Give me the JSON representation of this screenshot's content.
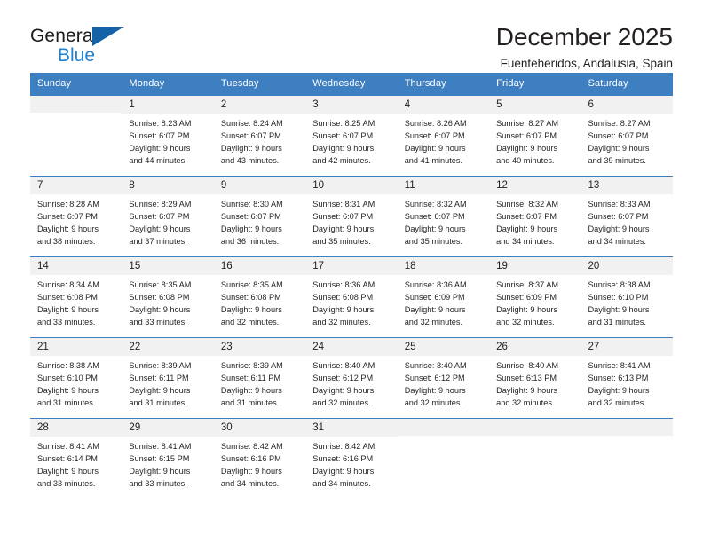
{
  "brand": {
    "word_one": "General",
    "word_two": "Blue",
    "triangle_icon": "triangle-icon"
  },
  "header": {
    "month_title": "December 2025",
    "location": "Fuenteheridos, Andalusia, Spain"
  },
  "colors": {
    "header_blue": "#3d7fc1",
    "brand_dark_blue": "#1463a8",
    "brand_light_blue": "#2083d2",
    "daynum_band": "#f1f1f1",
    "text": "#231f20"
  },
  "calendar": {
    "weekday_headers": [
      "Sunday",
      "Monday",
      "Tuesday",
      "Wednesday",
      "Thursday",
      "Friday",
      "Saturday"
    ],
    "labels": {
      "sunrise_prefix": "Sunrise:",
      "sunset_prefix": "Sunset:",
      "daylight_prefix": "Daylight:"
    },
    "weeks": [
      [
        {
          "day": "",
          "empty": true
        },
        {
          "day": "1",
          "sunrise": "Sunrise: 8:23 AM",
          "sunset": "Sunset: 6:07 PM",
          "daylight_l1": "Daylight: 9 hours",
          "daylight_l2": "and 44 minutes."
        },
        {
          "day": "2",
          "sunrise": "Sunrise: 8:24 AM",
          "sunset": "Sunset: 6:07 PM",
          "daylight_l1": "Daylight: 9 hours",
          "daylight_l2": "and 43 minutes."
        },
        {
          "day": "3",
          "sunrise": "Sunrise: 8:25 AM",
          "sunset": "Sunset: 6:07 PM",
          "daylight_l1": "Daylight: 9 hours",
          "daylight_l2": "and 42 minutes."
        },
        {
          "day": "4",
          "sunrise": "Sunrise: 8:26 AM",
          "sunset": "Sunset: 6:07 PM",
          "daylight_l1": "Daylight: 9 hours",
          "daylight_l2": "and 41 minutes."
        },
        {
          "day": "5",
          "sunrise": "Sunrise: 8:27 AM",
          "sunset": "Sunset: 6:07 PM",
          "daylight_l1": "Daylight: 9 hours",
          "daylight_l2": "and 40 minutes."
        },
        {
          "day": "6",
          "sunrise": "Sunrise: 8:27 AM",
          "sunset": "Sunset: 6:07 PM",
          "daylight_l1": "Daylight: 9 hours",
          "daylight_l2": "and 39 minutes."
        }
      ],
      [
        {
          "day": "7",
          "sunrise": "Sunrise: 8:28 AM",
          "sunset": "Sunset: 6:07 PM",
          "daylight_l1": "Daylight: 9 hours",
          "daylight_l2": "and 38 minutes."
        },
        {
          "day": "8",
          "sunrise": "Sunrise: 8:29 AM",
          "sunset": "Sunset: 6:07 PM",
          "daylight_l1": "Daylight: 9 hours",
          "daylight_l2": "and 37 minutes."
        },
        {
          "day": "9",
          "sunrise": "Sunrise: 8:30 AM",
          "sunset": "Sunset: 6:07 PM",
          "daylight_l1": "Daylight: 9 hours",
          "daylight_l2": "and 36 minutes."
        },
        {
          "day": "10",
          "sunrise": "Sunrise: 8:31 AM",
          "sunset": "Sunset: 6:07 PM",
          "daylight_l1": "Daylight: 9 hours",
          "daylight_l2": "and 35 minutes."
        },
        {
          "day": "11",
          "sunrise": "Sunrise: 8:32 AM",
          "sunset": "Sunset: 6:07 PM",
          "daylight_l1": "Daylight: 9 hours",
          "daylight_l2": "and 35 minutes."
        },
        {
          "day": "12",
          "sunrise": "Sunrise: 8:32 AM",
          "sunset": "Sunset: 6:07 PM",
          "daylight_l1": "Daylight: 9 hours",
          "daylight_l2": "and 34 minutes."
        },
        {
          "day": "13",
          "sunrise": "Sunrise: 8:33 AM",
          "sunset": "Sunset: 6:07 PM",
          "daylight_l1": "Daylight: 9 hours",
          "daylight_l2": "and 34 minutes."
        }
      ],
      [
        {
          "day": "14",
          "sunrise": "Sunrise: 8:34 AM",
          "sunset": "Sunset: 6:08 PM",
          "daylight_l1": "Daylight: 9 hours",
          "daylight_l2": "and 33 minutes."
        },
        {
          "day": "15",
          "sunrise": "Sunrise: 8:35 AM",
          "sunset": "Sunset: 6:08 PM",
          "daylight_l1": "Daylight: 9 hours",
          "daylight_l2": "and 33 minutes."
        },
        {
          "day": "16",
          "sunrise": "Sunrise: 8:35 AM",
          "sunset": "Sunset: 6:08 PM",
          "daylight_l1": "Daylight: 9 hours",
          "daylight_l2": "and 32 minutes."
        },
        {
          "day": "17",
          "sunrise": "Sunrise: 8:36 AM",
          "sunset": "Sunset: 6:08 PM",
          "daylight_l1": "Daylight: 9 hours",
          "daylight_l2": "and 32 minutes."
        },
        {
          "day": "18",
          "sunrise": "Sunrise: 8:36 AM",
          "sunset": "Sunset: 6:09 PM",
          "daylight_l1": "Daylight: 9 hours",
          "daylight_l2": "and 32 minutes."
        },
        {
          "day": "19",
          "sunrise": "Sunrise: 8:37 AM",
          "sunset": "Sunset: 6:09 PM",
          "daylight_l1": "Daylight: 9 hours",
          "daylight_l2": "and 32 minutes."
        },
        {
          "day": "20",
          "sunrise": "Sunrise: 8:38 AM",
          "sunset": "Sunset: 6:10 PM",
          "daylight_l1": "Daylight: 9 hours",
          "daylight_l2": "and 31 minutes."
        }
      ],
      [
        {
          "day": "21",
          "sunrise": "Sunrise: 8:38 AM",
          "sunset": "Sunset: 6:10 PM",
          "daylight_l1": "Daylight: 9 hours",
          "daylight_l2": "and 31 minutes."
        },
        {
          "day": "22",
          "sunrise": "Sunrise: 8:39 AM",
          "sunset": "Sunset: 6:11 PM",
          "daylight_l1": "Daylight: 9 hours",
          "daylight_l2": "and 31 minutes."
        },
        {
          "day": "23",
          "sunrise": "Sunrise: 8:39 AM",
          "sunset": "Sunset: 6:11 PM",
          "daylight_l1": "Daylight: 9 hours",
          "daylight_l2": "and 31 minutes."
        },
        {
          "day": "24",
          "sunrise": "Sunrise: 8:40 AM",
          "sunset": "Sunset: 6:12 PM",
          "daylight_l1": "Daylight: 9 hours",
          "daylight_l2": "and 32 minutes."
        },
        {
          "day": "25",
          "sunrise": "Sunrise: 8:40 AM",
          "sunset": "Sunset: 6:12 PM",
          "daylight_l1": "Daylight: 9 hours",
          "daylight_l2": "and 32 minutes."
        },
        {
          "day": "26",
          "sunrise": "Sunrise: 8:40 AM",
          "sunset": "Sunset: 6:13 PM",
          "daylight_l1": "Daylight: 9 hours",
          "daylight_l2": "and 32 minutes."
        },
        {
          "day": "27",
          "sunrise": "Sunrise: 8:41 AM",
          "sunset": "Sunset: 6:13 PM",
          "daylight_l1": "Daylight: 9 hours",
          "daylight_l2": "and 32 minutes."
        }
      ],
      [
        {
          "day": "28",
          "sunrise": "Sunrise: 8:41 AM",
          "sunset": "Sunset: 6:14 PM",
          "daylight_l1": "Daylight: 9 hours",
          "daylight_l2": "and 33 minutes."
        },
        {
          "day": "29",
          "sunrise": "Sunrise: 8:41 AM",
          "sunset": "Sunset: 6:15 PM",
          "daylight_l1": "Daylight: 9 hours",
          "daylight_l2": "and 33 minutes."
        },
        {
          "day": "30",
          "sunrise": "Sunrise: 8:42 AM",
          "sunset": "Sunset: 6:16 PM",
          "daylight_l1": "Daylight: 9 hours",
          "daylight_l2": "and 34 minutes."
        },
        {
          "day": "31",
          "sunrise": "Sunrise: 8:42 AM",
          "sunset": "Sunset: 6:16 PM",
          "daylight_l1": "Daylight: 9 hours",
          "daylight_l2": "and 34 minutes."
        },
        {
          "day": "",
          "empty": true
        },
        {
          "day": "",
          "empty": true
        },
        {
          "day": "",
          "empty": true
        }
      ]
    ]
  }
}
